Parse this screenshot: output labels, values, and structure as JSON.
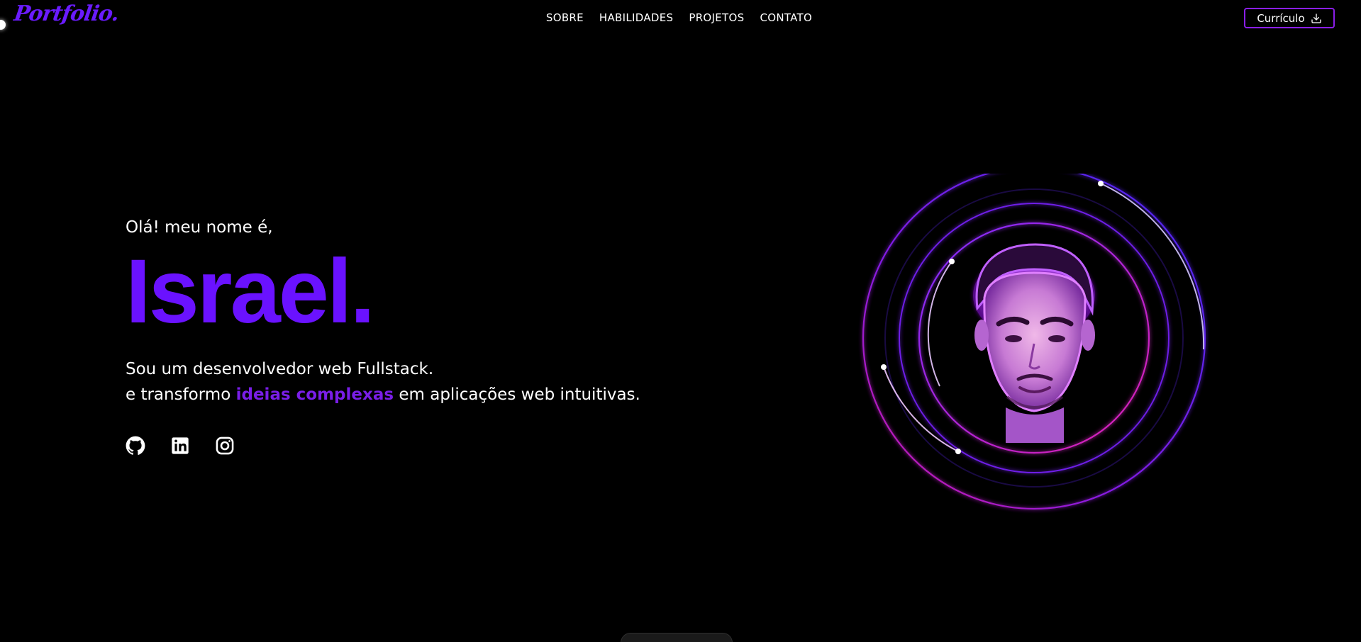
{
  "header": {
    "logo": "Portfolio.",
    "nav": [
      "SOBRE",
      "HABILIDADES",
      "PROJETOS",
      "CONTATO"
    ],
    "cv_button": "Currículo"
  },
  "hero": {
    "greeting": "Olá! meu nome é,",
    "name": "Israel.",
    "line1": "Sou um desenvolvedor web Fullstack.",
    "line2_prefix": "e transformo ",
    "line2_highlight": "ideias complexas",
    "line2_suffix": " em aplicações web intuitivas."
  },
  "socials": [
    {
      "icon": "github-icon"
    },
    {
      "icon": "linkedin-icon"
    },
    {
      "icon": "instagram-icon"
    }
  ],
  "colors": {
    "background": "#000000",
    "accent": "#6a12ff",
    "magenta": "#e01fb0",
    "button_border": "#8a1ee8"
  }
}
